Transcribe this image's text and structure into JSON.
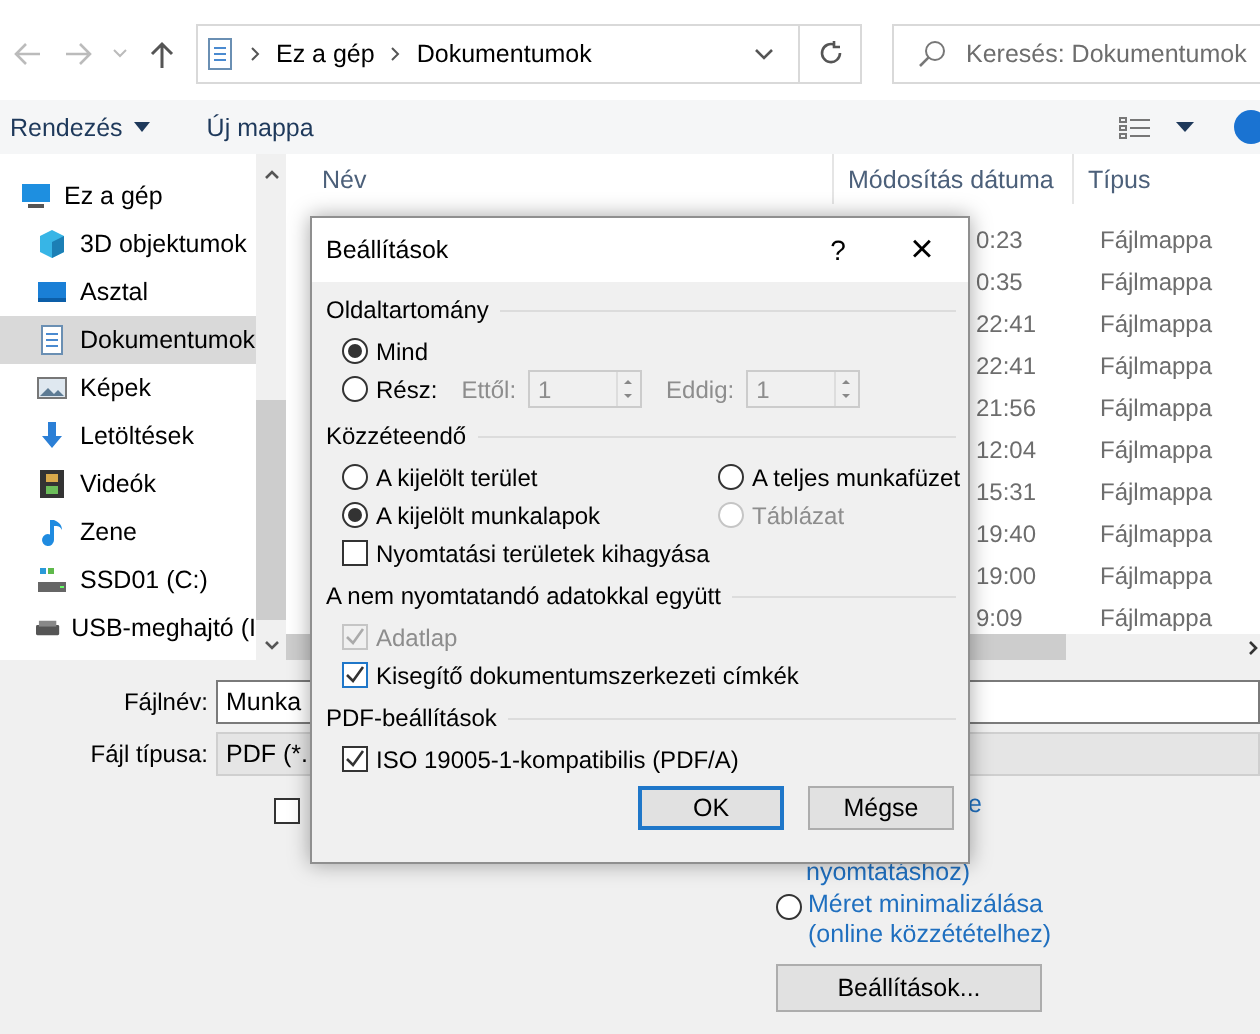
{
  "nav": {
    "address": [
      "Ez a gép",
      "Dokumentumok"
    ],
    "search": {
      "placeholder": "Keresés: Dokumentumok"
    }
  },
  "toolbar": {
    "organize": "Rendezés",
    "new_folder": "Új mappa"
  },
  "sidebar": {
    "items": [
      {
        "label": "Ez a gép",
        "kind": "computer",
        "selected": false
      },
      {
        "label": "3D objektumok",
        "kind": "cube",
        "selected": false
      },
      {
        "label": "Asztal",
        "kind": "desktop",
        "selected": false
      },
      {
        "label": "Dokumentumok",
        "kind": "document",
        "selected": true
      },
      {
        "label": "Képek",
        "kind": "images",
        "selected": false
      },
      {
        "label": "Letöltések",
        "kind": "download",
        "selected": false
      },
      {
        "label": "Videók",
        "kind": "film",
        "selected": false
      },
      {
        "label": "Zene",
        "kind": "music",
        "selected": false
      },
      {
        "label": "SSD01 (C:)",
        "kind": "system-drive",
        "selected": false
      },
      {
        "label": "USB-meghajtó (I",
        "kind": "drive",
        "selected": false
      }
    ]
  },
  "file_list": {
    "columns": [
      "Név",
      "Módosítás dátuma",
      "Típus"
    ],
    "rows": [
      {
        "modified": "0:23",
        "type": "Fájlmappa"
      },
      {
        "modified": "0:35",
        "type": "Fájlmappa"
      },
      {
        "modified": "22:41",
        "type": "Fájlmappa"
      },
      {
        "modified": "22:41",
        "type": "Fájlmappa"
      },
      {
        "modified": "21:56",
        "type": "Fájlmappa"
      },
      {
        "modified": "12:04",
        "type": "Fájlmappa"
      },
      {
        "modified": "15:31",
        "type": "Fájlmappa"
      },
      {
        "modified": "19:40",
        "type": "Fájlmappa"
      },
      {
        "modified": "19:00",
        "type": "Fájlmappa"
      },
      {
        "modified": "9:09",
        "type": "Fájlmappa"
      }
    ]
  },
  "save_form": {
    "filename_label": "Fájlnév:",
    "filename": "Munka",
    "filetype_label": "Fájl típusa:",
    "filetype": "PDF (*.",
    "option_checkbox": {
      "checked": false
    },
    "standard_link": [
      "e",
      "nyomtatáshoz)"
    ],
    "minimize": {
      "selected": false,
      "label": [
        "Méret minimalizálása",
        "(online közzétételhez)"
      ]
    },
    "options_button": "Beállítások..."
  },
  "dialog": {
    "title": "Beállítások",
    "help": "?",
    "close": "×",
    "page_range": {
      "heading": "Oldaltartomány",
      "all": {
        "label": "Mind",
        "selected": true
      },
      "part": {
        "label": "Rész:",
        "selected": false
      },
      "from": {
        "label": "Ettől:",
        "value": "1",
        "disabled": true
      },
      "to": {
        "label": "Eddig:",
        "value": "1",
        "disabled": true
      }
    },
    "publish": {
      "heading": "Közzéteendő",
      "options": [
        {
          "label": "A kijelölt terület",
          "selected": false,
          "disabled": false
        },
        {
          "label": "A teljes munkafüzet",
          "selected": false,
          "disabled": false
        },
        {
          "label": "A kijelölt munkalapok",
          "selected": true,
          "disabled": false
        },
        {
          "label": "Táblázat",
          "selected": false,
          "disabled": true
        }
      ],
      "ignore_print_areas": {
        "label": "Nyomtatási területek kihagyása",
        "checked": false
      }
    },
    "non_print": {
      "heading": "A nem nyomtatandó adatokkal együtt",
      "items": [
        {
          "label": "Adatlap",
          "checked": true,
          "disabled": true
        },
        {
          "label": "Kisegítő dokumentumszerkezeti címkék",
          "checked": true,
          "disabled": false
        }
      ]
    },
    "pdf": {
      "heading": "PDF-beállítások",
      "items": [
        {
          "label": "ISO 19005-1-kompatibilis (PDF/A)",
          "checked": true,
          "disabled": false
        }
      ]
    },
    "buttons": [
      "OK",
      "Mégse"
    ]
  }
}
